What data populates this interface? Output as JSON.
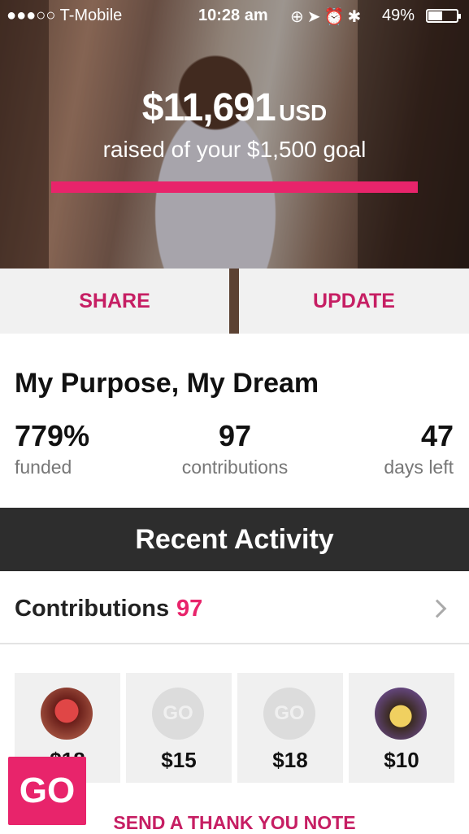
{
  "status_bar": {
    "carrier": "●●●○○ T-Mobile",
    "time": "10:28 am",
    "battery": "49%",
    "battery_level": 0.49
  },
  "hero": {
    "amount": "$11,691",
    "currency": "USD",
    "goal_text": "raised of your $1,500 goal",
    "progress_fraction": 1.0
  },
  "actions": {
    "share_label": "SHARE",
    "update_label": "UPDATE"
  },
  "campaign": {
    "title": "My Purpose, My Dream",
    "stats": [
      {
        "value": "779%",
        "label": "funded"
      },
      {
        "value": "97",
        "label": "contributions"
      },
      {
        "value": "47",
        "label": "days left"
      }
    ]
  },
  "activity": {
    "header": "Recent Activity",
    "contributions_label": "Contributions",
    "contributions_count": "97"
  },
  "contributions": [
    {
      "avatar": "photo",
      "amount": "$18"
    },
    {
      "avatar": "go",
      "avatar_text": "GO",
      "amount": "$15"
    },
    {
      "avatar": "go",
      "avatar_text": "GO",
      "amount": "$18"
    },
    {
      "avatar": "photo",
      "amount": "$10"
    }
  ],
  "go_badge": "GO",
  "thank_you_label": "SEND A THANK YOU NOTE",
  "colors": {
    "accent": "#e8246b",
    "accent_dark": "#c61e63",
    "band": "#2d2d2d"
  }
}
